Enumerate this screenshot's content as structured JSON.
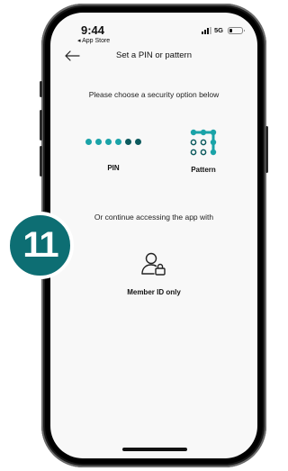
{
  "status_bar": {
    "time": "9:44",
    "back_label": "◂ App Store",
    "network": "5G"
  },
  "header": {
    "back_icon": "arrow-left-icon",
    "title": "Set a PIN or pattern"
  },
  "prompt": "Please choose a security option below",
  "options": {
    "pin": {
      "label": "PIN",
      "icon": "pin-dots-icon"
    },
    "pattern": {
      "label": "Pattern",
      "icon": "pattern-grid-icon"
    },
    "member_id": {
      "label": "Member ID only",
      "icon": "user-lock-icon"
    }
  },
  "continue_text": "Or continue accessing the app with",
  "step_badge": "11",
  "colors": {
    "accent": "#1aa3a8",
    "accent_dark": "#0d6e73",
    "dot_dark": "#0d5a5e",
    "badge": "#0d6e73"
  }
}
